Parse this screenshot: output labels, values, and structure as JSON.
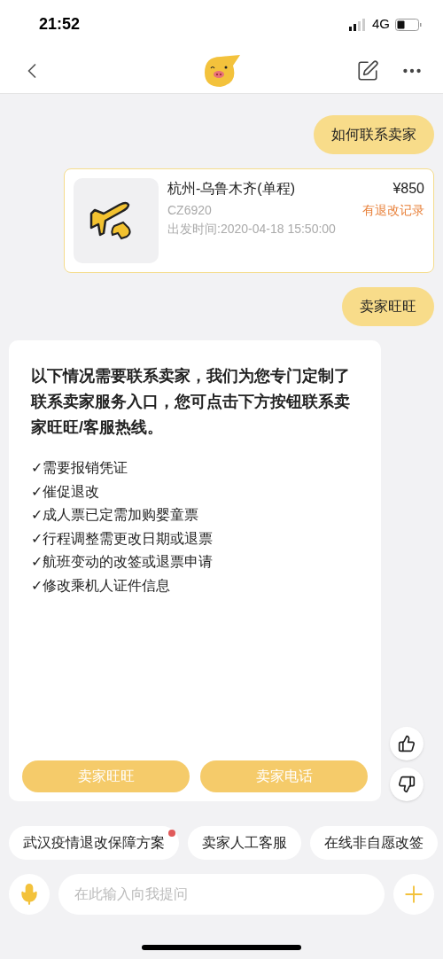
{
  "status_bar": {
    "time": "21:52",
    "network": "4G"
  },
  "messages": [
    {
      "kind": "user",
      "text": "如何联系卖家"
    },
    {
      "kind": "order",
      "route": "杭州-乌鲁木齐(单程)",
      "flight": "CZ6920",
      "departure": "出发时间:2020-04-18 15:50:00",
      "price": "¥850",
      "note": "有退改记录"
    },
    {
      "kind": "user",
      "text": "卖家旺旺"
    },
    {
      "kind": "bot",
      "intro": "以下情况需要联系卖家，我们为您专门定制了联系卖家服务入口，您可点击下方按钮联系卖家旺旺/客服热线。",
      "items": [
        "✓需要报销凭证",
        "✓催促退改",
        "✓成人票已定需加购婴童票",
        "✓行程调整需更改日期或退票",
        "✓航班变动的改签或退票申请",
        "✓修改乘机人证件信息"
      ],
      "buttons": [
        "卖家旺旺",
        "卖家电话"
      ]
    }
  ],
  "quick_replies": [
    {
      "label": "武汉疫情退改保障方案",
      "badge": true
    },
    {
      "label": "卖家人工客服",
      "badge": false
    },
    {
      "label": "在线非自愿改签",
      "badge": false
    }
  ],
  "input": {
    "placeholder": "在此输入向我提问"
  }
}
